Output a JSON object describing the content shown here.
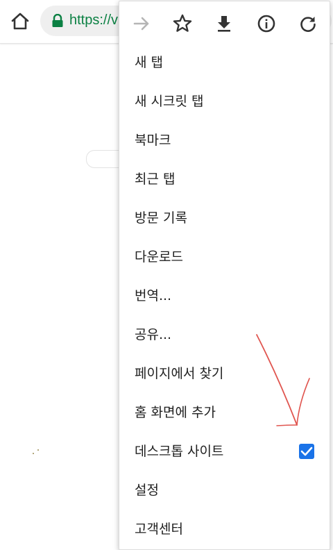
{
  "toolbar": {
    "url_text": "https://v",
    "home_icon": "home-icon",
    "lock_icon": "lock-icon"
  },
  "menu": {
    "icons": [
      "forward-icon",
      "bookmark-star-icon",
      "download-icon",
      "info-icon",
      "reload-icon"
    ],
    "items": [
      {
        "label": "새 탭"
      },
      {
        "label": "새 시크릿 탭"
      },
      {
        "label": "북마크"
      },
      {
        "label": "최근 탭"
      },
      {
        "label": "방문 기록"
      },
      {
        "label": "다운로드"
      },
      {
        "label": "번역..."
      },
      {
        "label": "공유..."
      },
      {
        "label": "페이지에서 찾기"
      },
      {
        "label": "홈 화면에 추가"
      },
      {
        "label": "데스크톱 사이트",
        "checked": true
      },
      {
        "label": "설정"
      },
      {
        "label": "고객센터"
      }
    ]
  },
  "colors": {
    "url": "#0b8043",
    "accent": "#1a73e8",
    "annotation_arrow": "#e0554f"
  }
}
